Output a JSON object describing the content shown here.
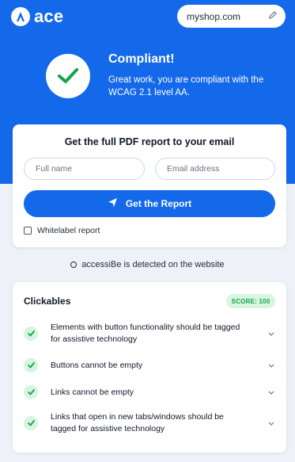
{
  "brand": {
    "name": "ace",
    "color": "#1468ea"
  },
  "header": {
    "domain": "myshop.com"
  },
  "status": {
    "title": "Compliant!",
    "description": "Great work, you are compliant with the WCAG 2.1 level AA."
  },
  "report": {
    "heading": "Get the full PDF report to your email",
    "name_placeholder": "Full name",
    "email_placeholder": "Email address",
    "button_label": "Get the Report",
    "whitelabel_label": "Whitelabel report"
  },
  "detected_note": "accessiBe is detected on the website",
  "clickables": {
    "title": "Clickables",
    "score": "SCORE: 100",
    "items": [
      {
        "label": "Elements with button functionality should be tagged for assistive technology"
      },
      {
        "label": "Buttons cannot be empty"
      },
      {
        "label": "Links cannot be empty"
      },
      {
        "label": "Links that open in new tabs/windows should be tagged for assistive technology"
      }
    ]
  },
  "colors": {
    "success": "#17a34a",
    "success_bg": "#d7f5df",
    "page_bg": "#eef2f8"
  },
  "icons": {
    "logo": "accessibe-a-icon",
    "edit": "pencil-icon",
    "status": "check-icon",
    "send": "paper-plane-icon",
    "expand": "chevron-down-icon"
  }
}
